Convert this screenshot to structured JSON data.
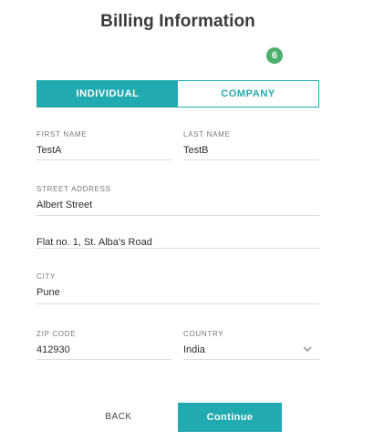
{
  "header": {
    "title": "Billing Information",
    "step_number": "6",
    "step_color": "#4bb06d"
  },
  "account_type": {
    "options": [
      "INDIVIDUAL",
      "COMPANY"
    ],
    "selected": "INDIVIDUAL",
    "accent_color": "#21aab0"
  },
  "form": {
    "first_name": {
      "label": "FIRST NAME",
      "value": "TestA"
    },
    "last_name": {
      "label": "LAST NAME",
      "value": "TestB"
    },
    "street_address": {
      "label": "STREET ADDRESS",
      "value": "Albert Street"
    },
    "address_line_2": {
      "label": "",
      "value": "Flat no. 1, St. Alba's Road"
    },
    "city": {
      "label": "CITY",
      "value": "Pune"
    },
    "zip_code": {
      "label": "ZIP CODE",
      "value": "412930"
    },
    "country": {
      "label": "COUNTRY",
      "value": "India",
      "icon": "chevron-down-icon"
    }
  },
  "actions": {
    "back_label": "BACK",
    "continue_label": "Continue"
  }
}
